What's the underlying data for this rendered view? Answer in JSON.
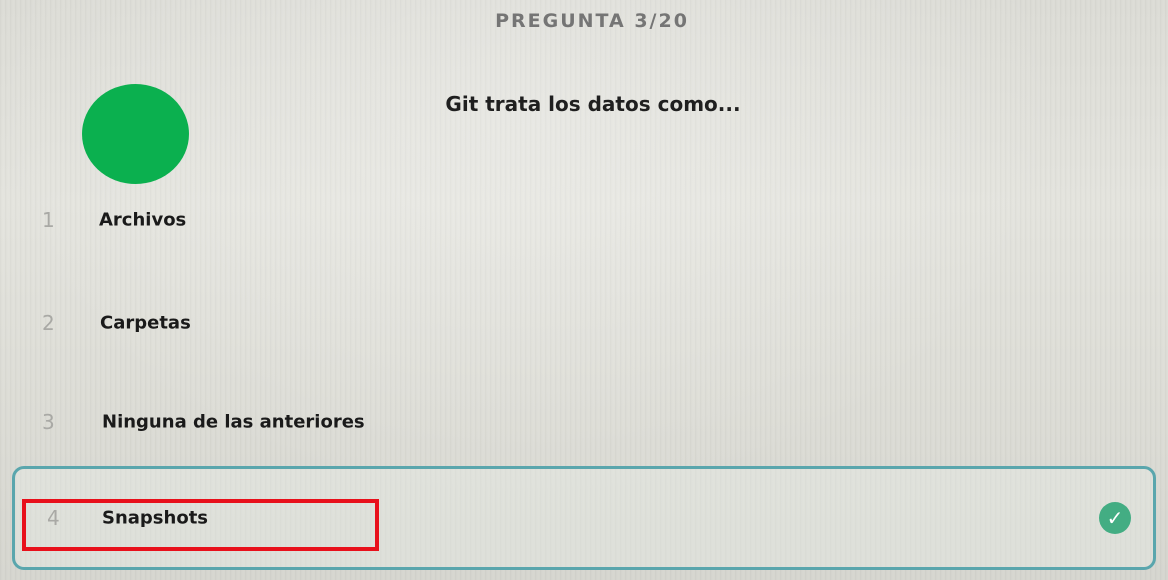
{
  "quiz": {
    "counter": "PREGUNTA 3/20",
    "question": "Git trata los datos como...",
    "options": [
      {
        "number": "1",
        "label": "Archivos",
        "selected": false
      },
      {
        "number": "2",
        "label": "Carpetas",
        "selected": false
      },
      {
        "number": "3",
        "label": "Ninguna de las anteriores",
        "selected": false
      },
      {
        "number": "4",
        "label": "Snapshots",
        "selected": true
      }
    ],
    "selected_icon": "check-circle-icon",
    "avatar_color": "#0bb04f",
    "accent_color": "#5aa6ad",
    "check_color": "#43ad83",
    "highlight_color": "#e8101b"
  }
}
